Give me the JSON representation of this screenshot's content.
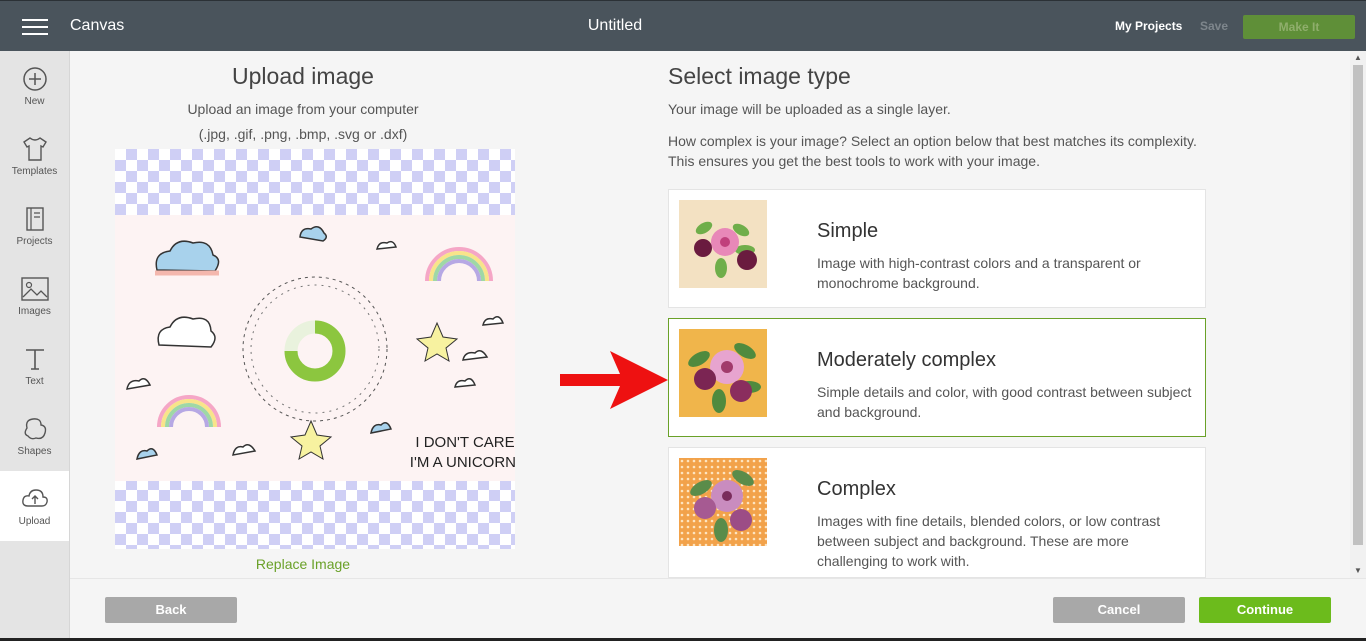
{
  "topbar": {
    "app_name": "Canvas",
    "doc_title": "Untitled",
    "my_projects": "My Projects",
    "save": "Save",
    "make_it": "Make It"
  },
  "sidebar": {
    "items": [
      {
        "label": "New",
        "icon": "plus-circle-icon"
      },
      {
        "label": "Templates",
        "icon": "tshirt-icon"
      },
      {
        "label": "Projects",
        "icon": "notebook-icon"
      },
      {
        "label": "Images",
        "icon": "image-icon"
      },
      {
        "label": "Text",
        "icon": "text-icon"
      },
      {
        "label": "Shapes",
        "icon": "shapes-icon"
      },
      {
        "label": "Upload",
        "icon": "upload-cloud-icon",
        "active": true
      }
    ]
  },
  "upload": {
    "title": "Upload image",
    "subtitle": "Upload an image from your computer",
    "formats": "(.jpg, .gif, .png, .bmp, .svg or .dxf)",
    "replace_label": "Replace Image",
    "art_text_line1": "I DON'T CARE",
    "art_text_line2": "I'M A UNICORN!"
  },
  "select_type": {
    "title": "Select image type",
    "intro": "Your image will be uploaded as a single layer.",
    "question": "How complex is your image? Select an option below that best matches its complexity. This ensures you get the best tools to work with your image.",
    "options": [
      {
        "title": "Simple",
        "description": "Image with high-contrast colors and a transparent or monochrome background.",
        "selected": false
      },
      {
        "title": "Moderately complex",
        "description": "Simple details and color, with good contrast between subject and background.",
        "selected": true
      },
      {
        "title": "Complex",
        "description": "Images with fine details, blended colors, or low contrast between subject and background. These are more challenging to work with.",
        "selected": false
      }
    ]
  },
  "footer": {
    "back": "Back",
    "cancel": "Cancel",
    "continue": "Continue"
  },
  "colors": {
    "topbar": "#4a545c",
    "accent_green": "#6cbb1c",
    "arrow_red": "#ee1111"
  }
}
